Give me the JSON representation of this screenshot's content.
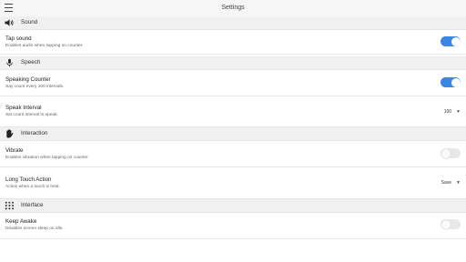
{
  "app": {
    "title": "Settings"
  },
  "sections": {
    "sound": {
      "label": "Sound"
    },
    "speech": {
      "label": "Speech"
    },
    "interaction": {
      "label": "Interaction"
    },
    "interface": {
      "label": "Interface"
    }
  },
  "settings": {
    "tap_sound": {
      "title": "Tap sound",
      "subtitle": "Enables audio when tapping on counter.",
      "value": true
    },
    "speaking_counter": {
      "title": "Speaking Counter",
      "subtitle": "Say count every 100 intervals.",
      "value": true
    },
    "speak_interval": {
      "title": "Speak Interval",
      "subtitle": "Set count interval to speak.",
      "value": "100"
    },
    "vibrate": {
      "title": "Vibrate",
      "subtitle": "Enables vibration when tapping on counter.",
      "value": false
    },
    "long_touch_action": {
      "title": "Long Touch Action",
      "subtitle": "Action when a touch is held.",
      "value": "Save"
    },
    "keep_awake": {
      "title": "Keep Awake",
      "subtitle": "Disables screen sleep on idle.",
      "value": false
    }
  },
  "colors": {
    "accent": "#3c84e6",
    "section_bg": "#f0f0f0",
    "toggle_off": "#e8e8e8"
  },
  "icons": {
    "menu": "hamburger-icon",
    "sound": "speaker-icon",
    "speech": "microphone-icon",
    "interaction": "hand-icon",
    "interface": "grid-icon",
    "dropdown": "chevron-down-icon"
  }
}
